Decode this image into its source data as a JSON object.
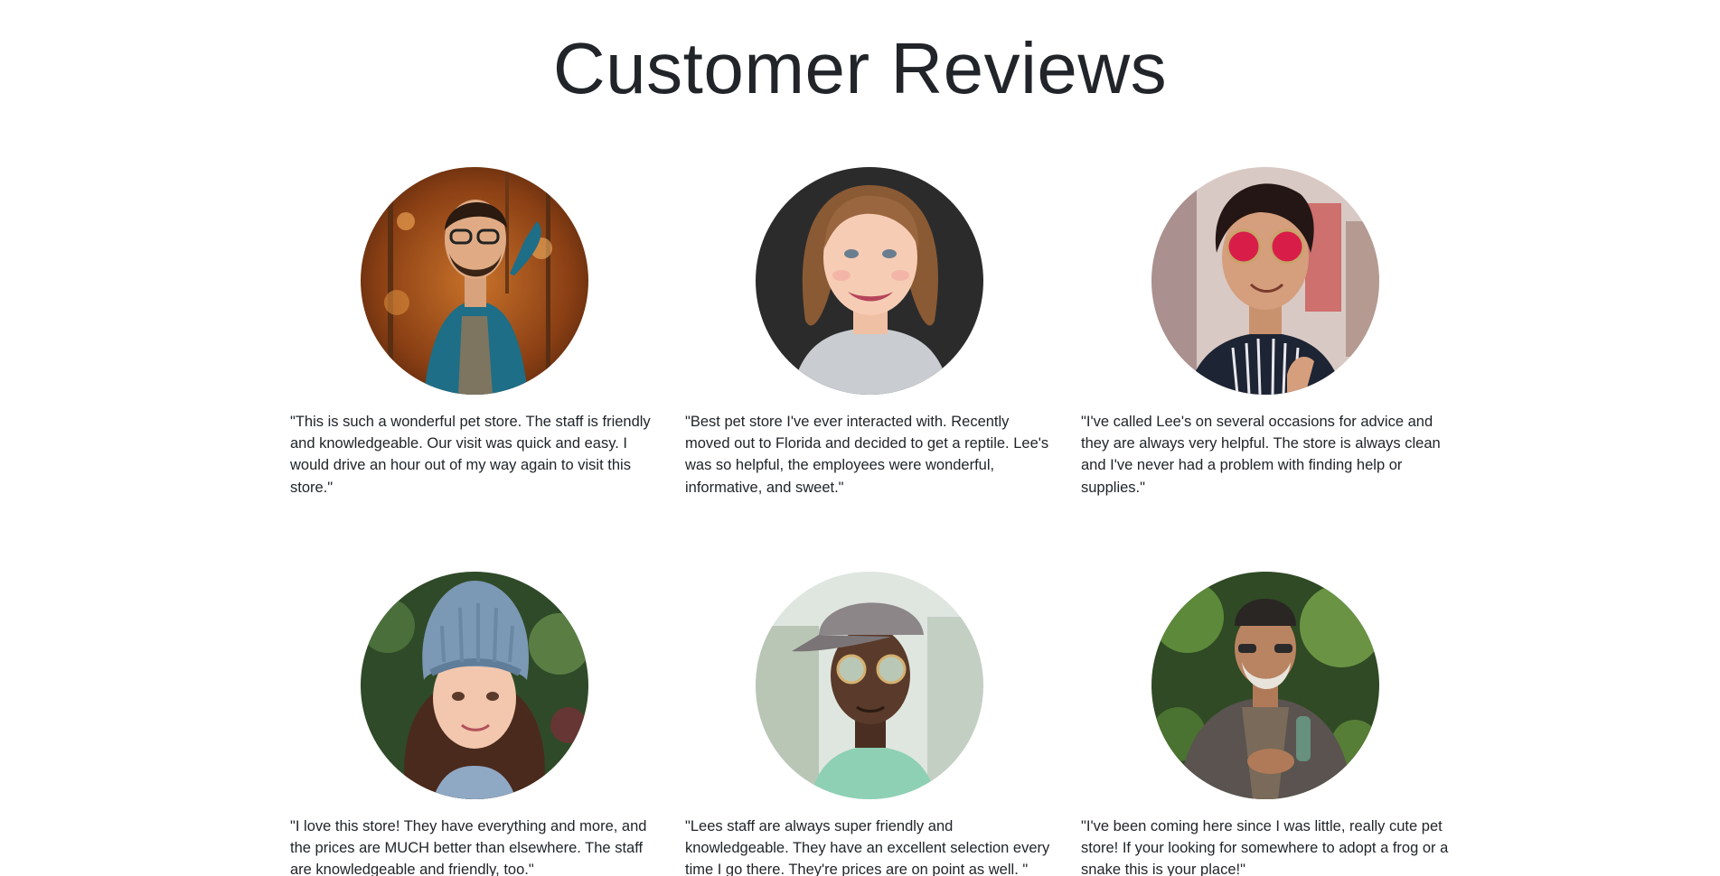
{
  "page": {
    "title": "Customer Reviews"
  },
  "reviews": [
    {
      "text": "\"This is such a wonderful pet store. The staff is friendly and knowledgeable. Our visit was quick and easy. I would drive an hour out of my way again to visit this store.\"",
      "photo": "man-glasses-teal-cardigan-autumn-trees"
    },
    {
      "text": "\"Best pet store I've ever interacted with. Recently moved out to Florida and decided to get a reptile. Lee's was so helpful, the employees were wonderful, informative, and sweet.\"",
      "photo": "smiling-woman-auburn-hair-dark-background"
    },
    {
      "text": "\"I've called Lee's on several occasions for advice and they are always very helpful. The store is always clean and I've never had a problem with finding help or supplies.\"",
      "photo": "person-red-round-sunglasses-striped-shirt"
    },
    {
      "text": "\"I love this store! They have everything and more, and the prices are MUCH better than elsewhere. The staff are knowledgeable and friendly, too.\"",
      "photo": "girl-blue-knit-beanie-green-foliage"
    },
    {
      "text": "\"Lees staff are always super friendly and knowledgeable. They have an excellent selection every time I go there. They're prices are on point as well. \"",
      "photo": "man-cap-round-sunglasses-mint-tshirt"
    },
    {
      "text": "\"I've been coming here since I was little, really cute pet store! If your looking for somewhere to adopt a frog or a snake this is your place!\"",
      "photo": "elderly-man-beanie-jacket-green-trees"
    }
  ],
  "colors": {
    "text": "#212529",
    "background": "#ffffff"
  }
}
